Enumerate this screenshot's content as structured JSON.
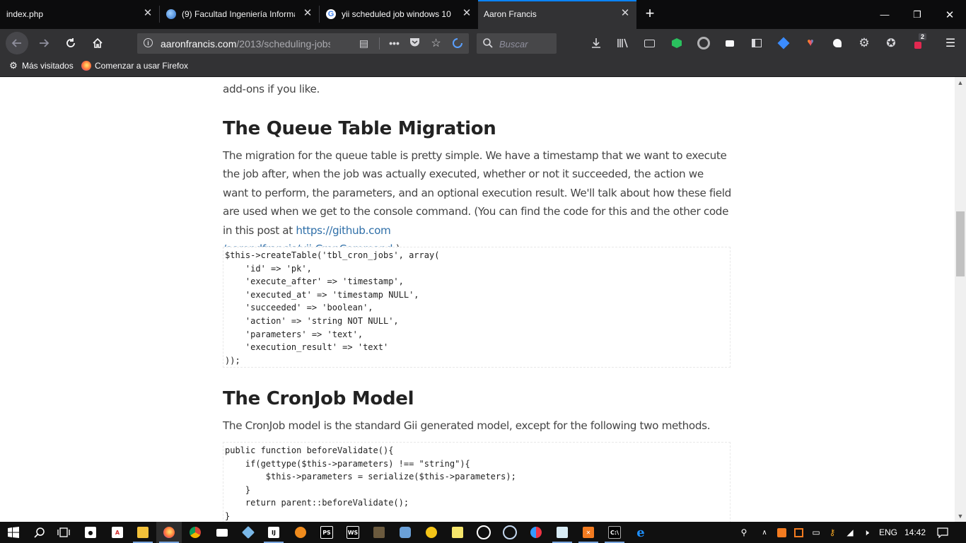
{
  "tabs": [
    {
      "title": "index.php",
      "active": false
    },
    {
      "title": "(9) Facultad Ingeniería Informá",
      "active": false
    },
    {
      "title": "yii scheduled job windows 10",
      "active": false
    },
    {
      "title": "Aaron Francis",
      "active": true
    }
  ],
  "nav": {
    "url_domain": "aaronfrancis.com",
    "url_path": "/2013/scheduling-jobs",
    "search_placeholder": "Buscar",
    "badge_count": "2"
  },
  "bookmarks": [
    {
      "label": "Más visitados",
      "icon": "gear-icon"
    },
    {
      "label": "Comenzar a usar Firefox",
      "icon": "firefox-icon"
    }
  ],
  "article": {
    "intro_tail": "add-ons if you like.",
    "heading1": "The Queue Table Migration",
    "para1_text": "The migration for the queue table is pretty simple. We have a timestamp that we want to execute the job after, when the job was actually executed, whether or not it succeeded, the action we want to perform, the parameters, and an optional execution result. We'll talk about how these field are used when we get to the console command. (You can find the code for this and the other code in this post at ",
    "para1_link1": "https://github.com",
    "para1_link2": "/aarondfrancis/yii-CronCommand",
    "para1_end": ".)",
    "code1": "$this->createTable('tbl_cron_jobs', array(\n    'id' => 'pk',\n    'execute_after' => 'timestamp',\n    'executed_at' => 'timestamp NULL',\n    'succeeded' => 'boolean',\n    'action' => 'string NOT NULL',\n    'parameters' => 'text',\n    'execution_result' => 'text'\n));",
    "heading2": "The CronJob Model",
    "para2": "The CronJob model is the standard Gii generated model, except for the following two methods.",
    "code2": "public function beforeValidate(){\n    if(gettype($this->parameters) !== \"string\"){\n        $this->parameters = serialize($this->parameters);\n    }\n    return parent::beforeValidate();\n}"
  },
  "taskbar": {
    "language": "ENG",
    "time": "14:42"
  },
  "colors": {
    "tab_strip": "#0c0c0d",
    "toolbar": "#323234",
    "active_tab_accent": "#0a84ff",
    "link": "#2f6fa8"
  }
}
